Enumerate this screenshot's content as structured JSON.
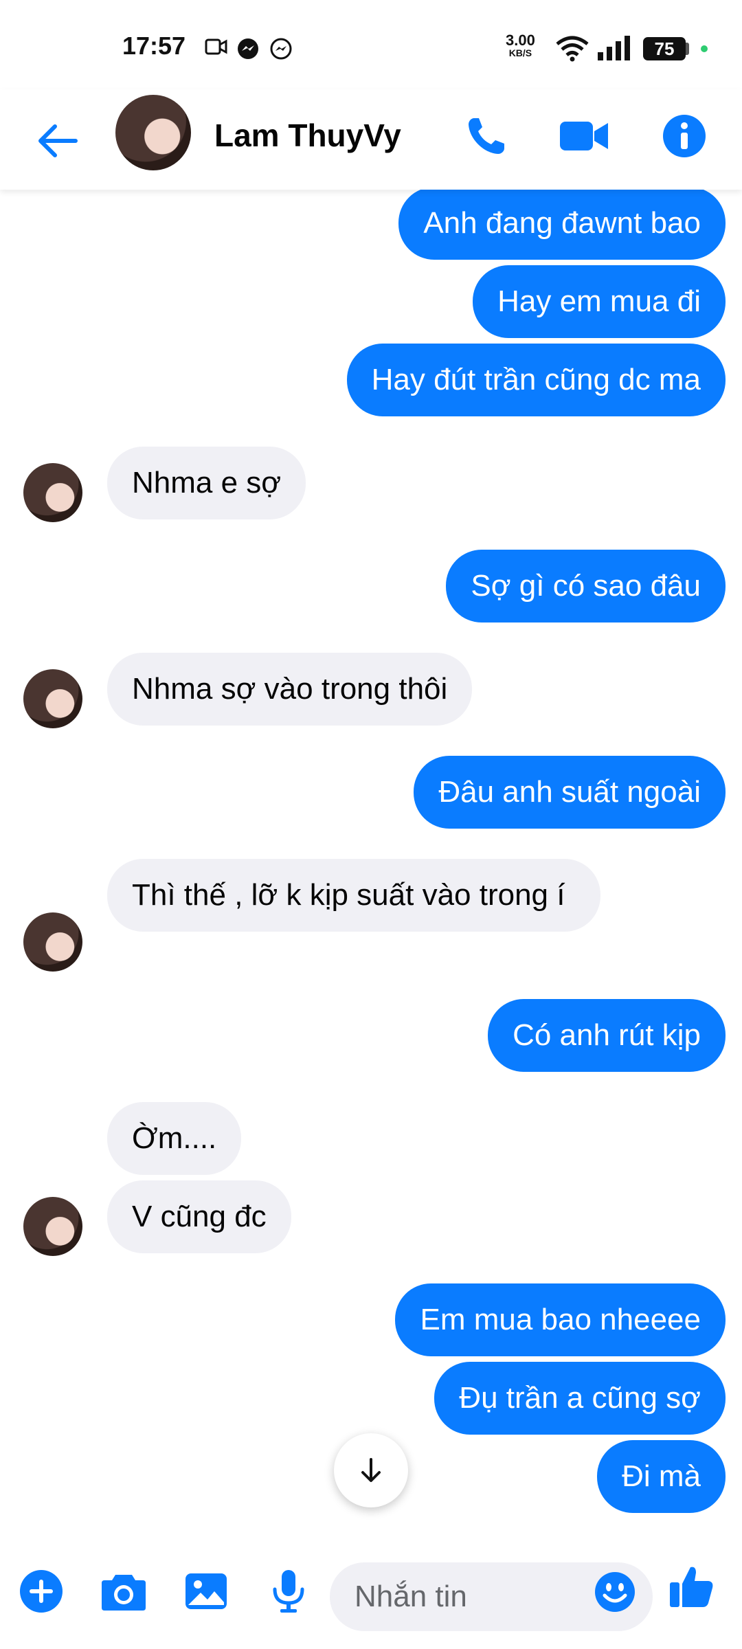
{
  "status_bar": {
    "time": "17:57",
    "net_speed": "3.00",
    "net_unit": "KB/S",
    "battery": "75"
  },
  "header": {
    "contact_name": "Lam ThuyVy"
  },
  "colors": {
    "accent": "#0a7cff",
    "incoming_bubble": "#f0f0f5"
  },
  "messages": [
    {
      "dir": "out",
      "text": "Anh đang đawnt bao"
    },
    {
      "dir": "out",
      "text": "Hay em mua đi"
    },
    {
      "dir": "out",
      "text": "Hay đút trần cũng dc ma"
    },
    {
      "dir": "in",
      "text": "Nhma e sợ"
    },
    {
      "dir": "out",
      "text": "Sợ gì có sao đâu"
    },
    {
      "dir": "in",
      "text": "Nhma sợ vào trong thôi"
    },
    {
      "dir": "out",
      "text": "Đâu anh suất ngoài"
    },
    {
      "dir": "in",
      "text": "Thì thế , lỡ k kịp suất vào trong í"
    },
    {
      "dir": "out",
      "text": "Có anh rút kịp"
    },
    {
      "dir": "in",
      "text": "Ờm...."
    },
    {
      "dir": "in",
      "text": "V cũng đc"
    },
    {
      "dir": "out",
      "text": "Em mua bao nheeee"
    },
    {
      "dir": "out",
      "text": "Đụ trần a cũng sợ"
    },
    {
      "dir": "out",
      "text": "Đi mà"
    }
  ],
  "composer": {
    "placeholder": "Nhắn tin"
  }
}
